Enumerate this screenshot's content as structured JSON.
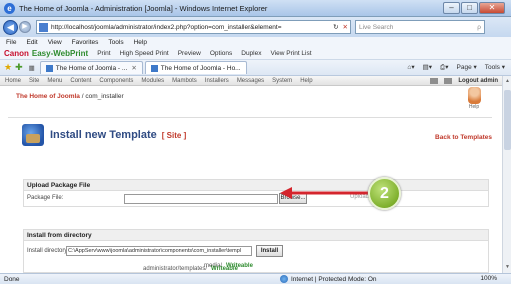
{
  "window": {
    "title": "The Home of Joomla - Administration [Joomla] - Windows Internet Explorer",
    "minimize": "–",
    "maximize": "□",
    "close": "✕"
  },
  "addressbar": {
    "url": "http://localhost/joomla/administrator/index2.php?option=com_installer&element=",
    "refresh": "↻",
    "stop": "✕",
    "search_placeholder": "Live Search",
    "search_icon": "ρ"
  },
  "menubar": [
    "File",
    "Edit",
    "View",
    "Favorites",
    "Tools",
    "Help"
  ],
  "canon_toolbar": {
    "brand": "Canon",
    "product": "Easy-WebPrint",
    "items": [
      "Print",
      "High Speed Print",
      "Preview",
      "Options",
      "Duplex",
      "View Print List"
    ]
  },
  "tabs": [
    {
      "label": "The Home of Joomla - ..."
    },
    {
      "label": "The Home of Joomla - Ho..."
    }
  ],
  "tab_tools": [
    "Page ▾",
    "Tools ▾"
  ],
  "joomla": {
    "menu": [
      "Home",
      "Site",
      "Menu",
      "Content",
      "Components",
      "Modules",
      "Mambots",
      "Installers",
      "Messages",
      "System",
      "Help"
    ],
    "logout": "Logout admin",
    "breadcrumb_home": "The Home of Joomla",
    "breadcrumb_rest": " / com_installer",
    "help_label": "Help",
    "page_title": "Install new Template",
    "page_sub": "[ Site ]",
    "back_link": "Back to Templates",
    "upload": {
      "header": "Upload Package File",
      "label": "Package File:",
      "browse": "Browse...",
      "upload_button": "Upload File"
    },
    "directory": {
      "header": "Install from directory",
      "label": "Install directory:",
      "value": "C:\\AppServ\\www\\joomla\\administrator\\components\\com_installer\\templ",
      "install_button": "Install"
    },
    "writable": [
      {
        "path": "media/",
        "status": "Writeable"
      },
      {
        "path": "administrator/templates/",
        "status": "Writeable"
      }
    ]
  },
  "callout": {
    "number": "2"
  },
  "statusbar": {
    "left": "Done",
    "zone": "Internet | Protected Mode: On",
    "zoom": "100%"
  }
}
